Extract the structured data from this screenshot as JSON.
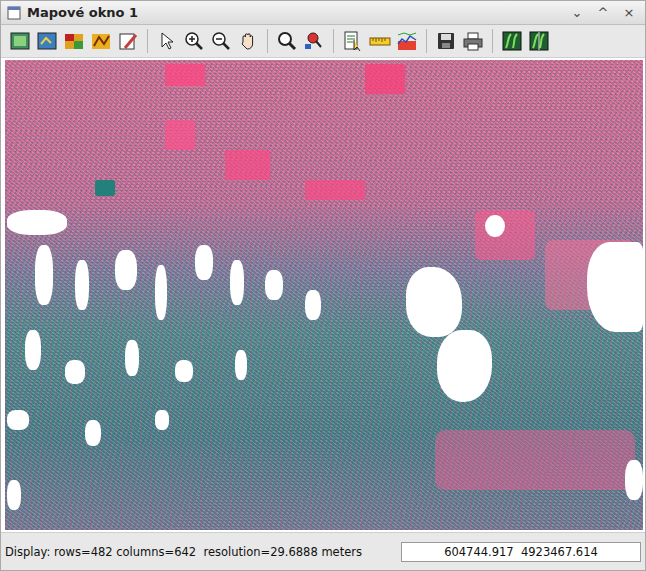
{
  "window": {
    "title": "Mapové okno 1",
    "controls": [
      "⌄",
      "^",
      "×"
    ]
  },
  "status_bar": {
    "display": "Display: rows=482 columns=642  resolution=29.6888 meters",
    "coordinates": "604744.917  4923467.614"
  }
}
